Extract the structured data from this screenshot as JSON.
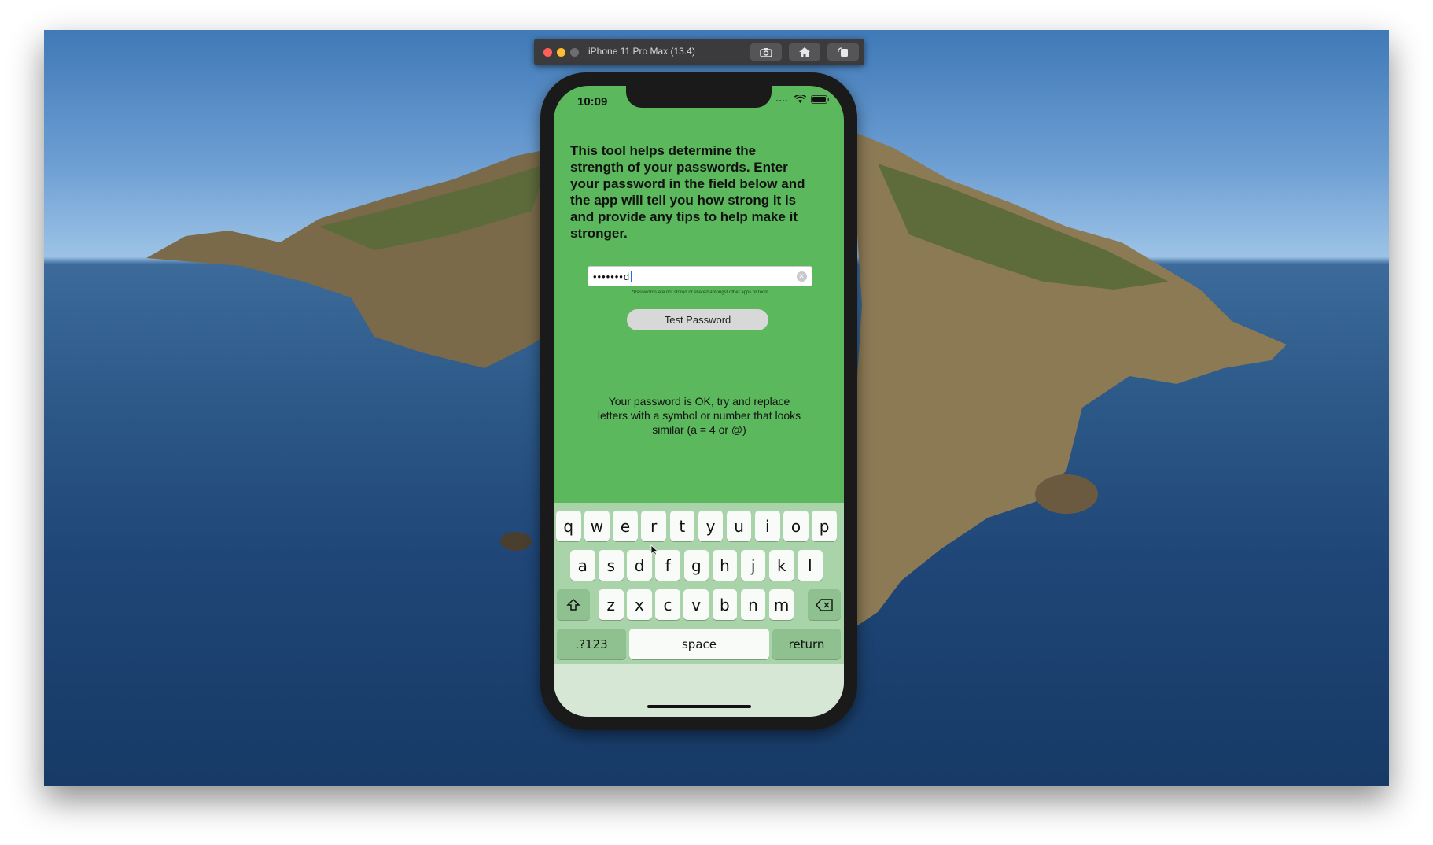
{
  "simulator": {
    "title": "iPhone 11 Pro Max (13.4)",
    "icons": [
      "screenshot-icon",
      "home-icon",
      "rotate-icon"
    ]
  },
  "status_bar": {
    "time": "10:09"
  },
  "app": {
    "intro": "This tool helps determine the strength of your passwords. Enter your password in the field below and the app will tell you how strong it is and provide any tips to help make it stronger.",
    "password_value": "•••••••d",
    "disclaimer": "*Passwords are not stored or shared amongst other apps or tools",
    "test_button": "Test Password",
    "result": "Your password is OK, try and replace letters with a symbol or number that looks similar (a = 4 or @)"
  },
  "keyboard": {
    "row1": [
      "q",
      "w",
      "e",
      "r",
      "t",
      "y",
      "u",
      "i",
      "o",
      "p"
    ],
    "row2": [
      "a",
      "s",
      "d",
      "f",
      "g",
      "h",
      "j",
      "k",
      "l"
    ],
    "row3": [
      "z",
      "x",
      "c",
      "v",
      "b",
      "n",
      "m"
    ],
    "numbers_key": ".?123",
    "space_key": "space",
    "return_key": "return"
  },
  "colors": {
    "app_background": "#5cb85c",
    "keyboard_background": "#a9d4a9"
  }
}
